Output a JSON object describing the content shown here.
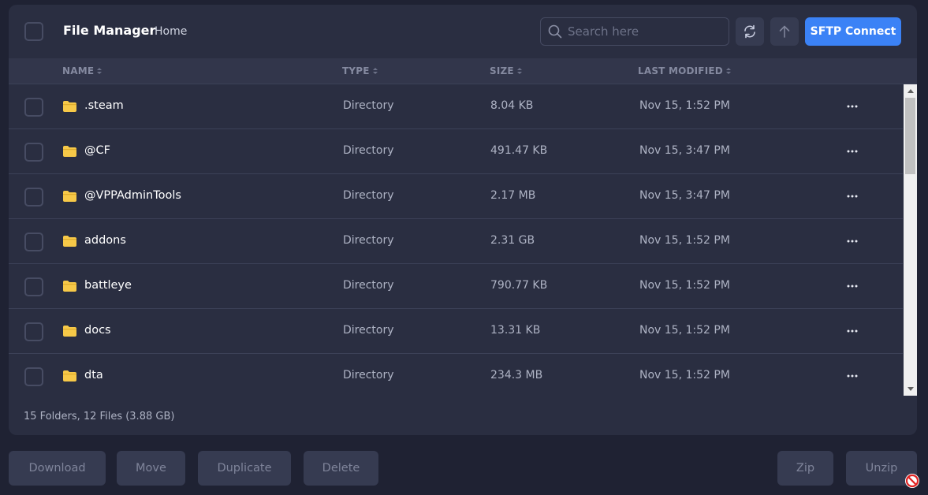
{
  "header": {
    "title": "File Manager",
    "breadcrumb": "Home",
    "search_placeholder": "Search here",
    "sftp_label": "SFTP Connect"
  },
  "columns": {
    "name": "NAME",
    "type": "TYPE",
    "size": "SIZE",
    "modified": "LAST MODIFIED"
  },
  "files": [
    {
      "name": ".steam",
      "type": "Directory",
      "size": "8.04 KB",
      "modified": "Nov 15, 1:52 PM"
    },
    {
      "name": "@CF",
      "type": "Directory",
      "size": "491.47 KB",
      "modified": "Nov 15, 3:47 PM"
    },
    {
      "name": "@VPPAdminTools",
      "type": "Directory",
      "size": "2.17 MB",
      "modified": "Nov 15, 3:47 PM"
    },
    {
      "name": "addons",
      "type": "Directory",
      "size": "2.31 GB",
      "modified": "Nov 15, 1:52 PM"
    },
    {
      "name": "battleye",
      "type": "Directory",
      "size": "790.77 KB",
      "modified": "Nov 15, 1:52 PM"
    },
    {
      "name": "docs",
      "type": "Directory",
      "size": "13.31 KB",
      "modified": "Nov 15, 1:52 PM"
    },
    {
      "name": "dta",
      "type": "Directory",
      "size": "234.3 MB",
      "modified": "Nov 15, 1:52 PM"
    }
  ],
  "status": "15 Folders, 12 Files (3.88 GB)",
  "actions": {
    "download": "Download",
    "move": "Move",
    "duplicate": "Duplicate",
    "delete": "Delete",
    "zip": "Zip",
    "unzip": "Unzip"
  },
  "colors": {
    "background": "#1f2233",
    "panel": "#2a2e41",
    "accent": "#3b82f6",
    "folder": "#f7c948"
  },
  "icons": {
    "search": "search-icon",
    "refresh": "refresh-icon",
    "upload": "arrow-up-icon",
    "folder": "folder-icon",
    "more": "more-icon",
    "sort": "sort-icon",
    "blocked": "blocked-icon"
  }
}
